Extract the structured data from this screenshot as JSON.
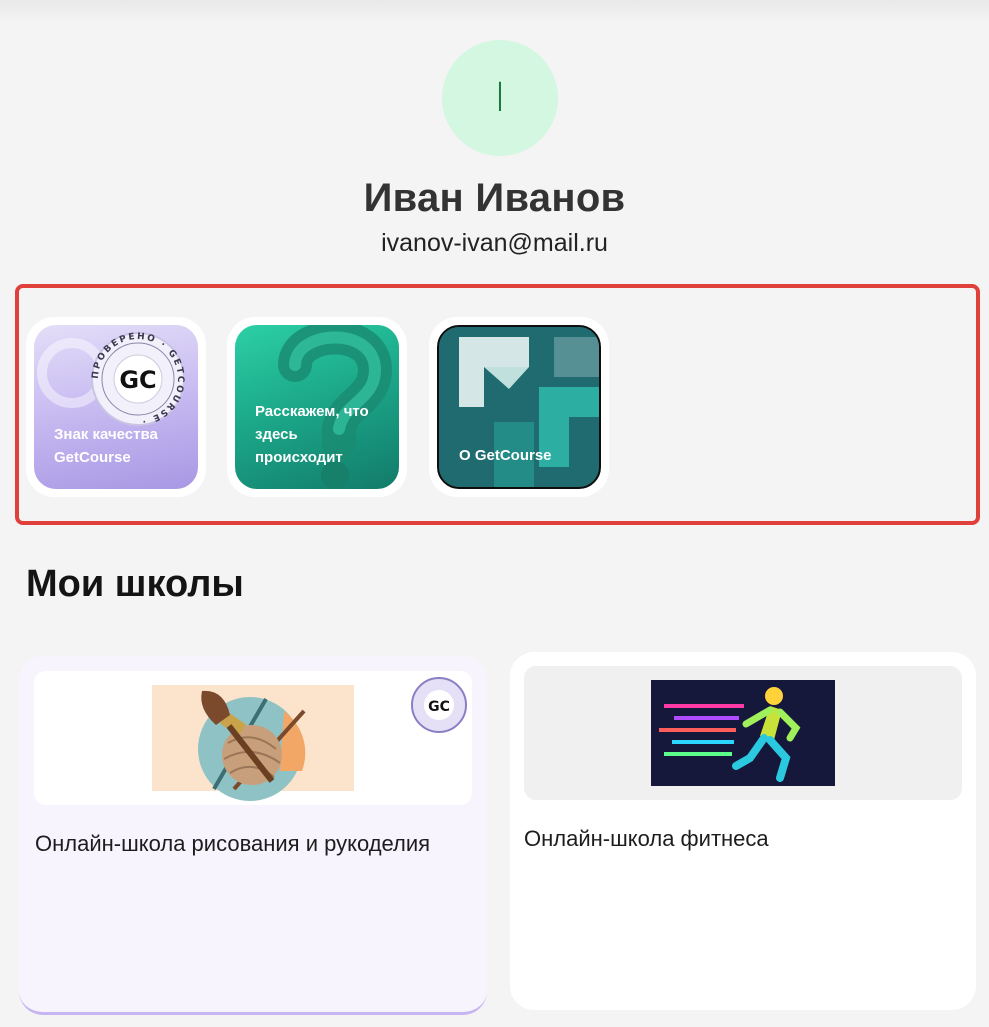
{
  "profile": {
    "avatar_initial": "I",
    "name": "Иван Иванов",
    "email": "ivanov-ivan@mail.ru"
  },
  "stories": [
    {
      "label": "Знак качества GetCourse",
      "icon": "quality-seal-icon"
    },
    {
      "label": "Расскажем, что здесь происходит",
      "icon": "question-mark-icon"
    },
    {
      "label": "О GetCourse",
      "icon": "getcourse-logo-icon"
    }
  ],
  "badge": {
    "ring_text": "ПРОВЕРЕНО · GETCOURSE ·",
    "logo_text": "GC"
  },
  "schools_section": {
    "title": "Мои школы",
    "cards": [
      {
        "title": "Онлайн-школа рисования и рукоделия",
        "image": "craft-tools-image",
        "verified": true
      },
      {
        "title": "Онлайн-школа фитнеса",
        "image": "running-man-image",
        "verified": false
      }
    ]
  },
  "colors": {
    "background": "#f4f4f4",
    "avatar_bg": "#d3f7e1",
    "avatar_text": "#1d7a3b",
    "highlight_frame": "#e0403a",
    "story_purple": "#a897e4",
    "story_green": "#1ca98a",
    "story_teal": "#1a5a60",
    "card_accent": "#c6b5f0"
  }
}
